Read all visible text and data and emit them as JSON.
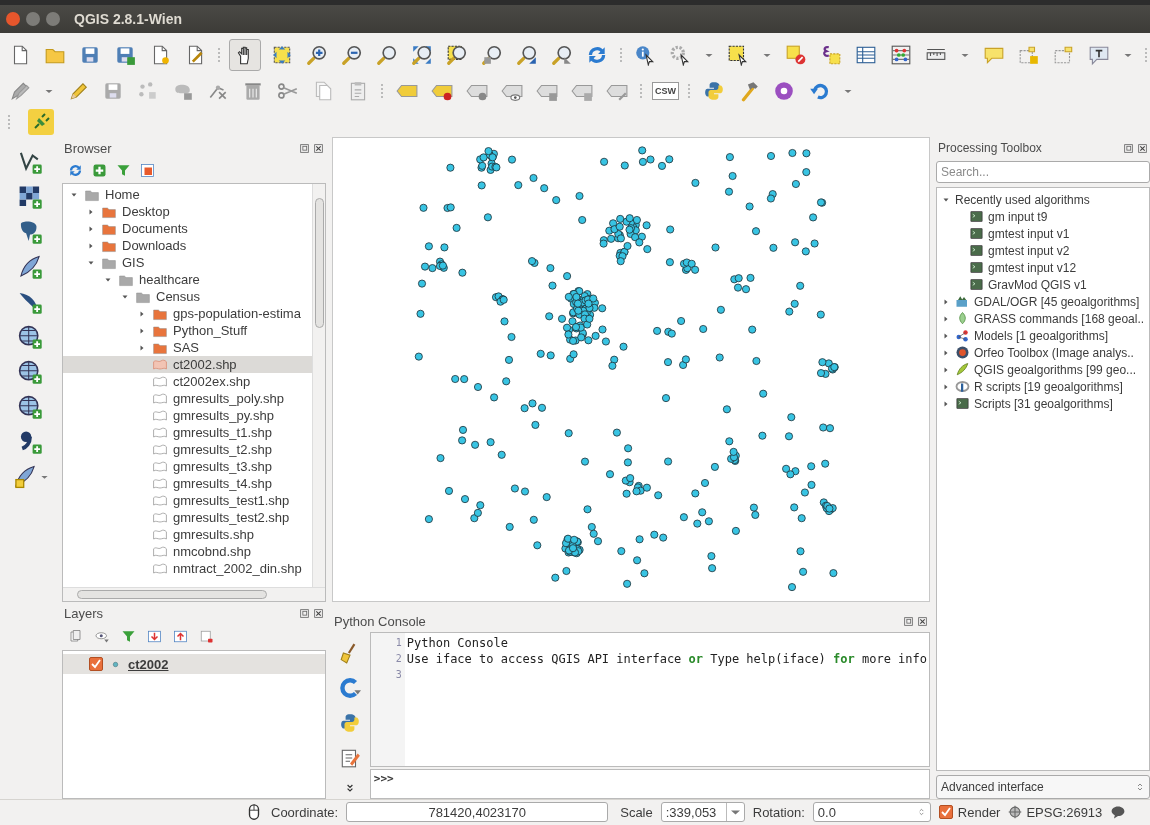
{
  "window": {
    "title": "QGIS 2.8.1-Wien"
  },
  "toolbar": {
    "pan_tool": {
      "selected": true
    },
    "csw_label": "CSW"
  },
  "browser": {
    "title": "Browser",
    "tree": [
      {
        "label": "Home",
        "kind": "folder",
        "expanded": true,
        "selected": false,
        "children": [
          {
            "label": "Desktop",
            "kind": "folder",
            "expanded": false,
            "selected": false
          },
          {
            "label": "Documents",
            "kind": "folder",
            "expanded": false,
            "selected": false
          },
          {
            "label": "Downloads",
            "kind": "folder",
            "expanded": false,
            "selected": false
          },
          {
            "label": "GIS",
            "kind": "folder",
            "expanded": true,
            "selected": false,
            "children": [
              {
                "label": "healthcare",
                "kind": "folder",
                "expanded": true,
                "selected": false,
                "children": [
                  {
                    "label": "Census",
                    "kind": "folder",
                    "expanded": true,
                    "selected": false,
                    "children": [
                      {
                        "label": "gps-population-estima",
                        "kind": "folder",
                        "expanded": false,
                        "selected": false
                      },
                      {
                        "label": "Python_Stuff",
                        "kind": "folder",
                        "expanded": false,
                        "selected": false
                      },
                      {
                        "label": "SAS",
                        "kind": "folder",
                        "expanded": false,
                        "selected": false
                      },
                      {
                        "label": "ct2002.shp",
                        "kind": "file",
                        "selected": true
                      },
                      {
                        "label": "ct2002ex.shp",
                        "kind": "file",
                        "selected": false
                      },
                      {
                        "label": "gmresults_poly.shp",
                        "kind": "file",
                        "selected": false
                      },
                      {
                        "label": "gmresults_py.shp",
                        "kind": "file",
                        "selected": false
                      },
                      {
                        "label": "gmresults_t1.shp",
                        "kind": "file",
                        "selected": false
                      },
                      {
                        "label": "gmresults_t2.shp",
                        "kind": "file",
                        "selected": false
                      },
                      {
                        "label": "gmresults_t3.shp",
                        "kind": "file",
                        "selected": false
                      },
                      {
                        "label": "gmresults_t4.shp",
                        "kind": "file",
                        "selected": false
                      },
                      {
                        "label": "gmresults_test1.shp",
                        "kind": "file",
                        "selected": false
                      },
                      {
                        "label": "gmresults_test2.shp",
                        "kind": "file",
                        "selected": false
                      },
                      {
                        "label": "gmresults.shp",
                        "kind": "file",
                        "selected": false
                      },
                      {
                        "label": "nmcobnd.shp",
                        "kind": "file",
                        "selected": false
                      },
                      {
                        "label": "nmtract_2002_din.shp",
                        "kind": "file",
                        "selected": false
                      }
                    ]
                  }
                ]
              }
            ]
          }
        ]
      }
    ]
  },
  "layers": {
    "title": "Layers",
    "items": [
      {
        "label": "ct2002",
        "checked": true,
        "selected": true
      }
    ]
  },
  "console": {
    "title": "Python Console",
    "lines": [
      {
        "number": "1",
        "segments": [
          {
            "text": "Python Console",
            "kind": "plain"
          }
        ]
      },
      {
        "number": "2",
        "segments": [
          {
            "text": "Use iface to access QGIS API interface ",
            "kind": "plain"
          },
          {
            "text": "or",
            "kind": "keyword"
          },
          {
            "text": " Type help(iface) ",
            "kind": "plain"
          },
          {
            "text": "for",
            "kind": "keyword"
          },
          {
            "text": " more info",
            "kind": "plain"
          }
        ]
      },
      {
        "number": "3"
      }
    ],
    "prompt": ">>>"
  },
  "toolbox": {
    "title": "Processing Toolbox",
    "search": {
      "placeholder": "Search..."
    },
    "groups": [
      {
        "label": "Recently used algorithms",
        "kind": "recent",
        "expanded": true,
        "children": [
          {
            "label": "gm input t9"
          },
          {
            "label": "gmtest input v1"
          },
          {
            "label": "gmtest input v2"
          },
          {
            "label": "gmtest input v12"
          },
          {
            "label": "GravMod QGIS v1"
          }
        ]
      },
      {
        "label": "GDAL/OGR [45 geoalgorithms]",
        "kind": "gdal",
        "expanded": false
      },
      {
        "label": "GRASS commands [168 geoal..",
        "kind": "grass",
        "expanded": false
      },
      {
        "label": "Models [1 geoalgorithms]",
        "kind": "models",
        "expanded": false
      },
      {
        "label": "Orfeo Toolbox (Image analys..",
        "kind": "orfeo",
        "expanded": false
      },
      {
        "label": "QGIS geoalgorithms [99 geo...",
        "kind": "qgis",
        "expanded": false
      },
      {
        "label": "R scripts [19 geoalgorithms]",
        "kind": "r",
        "expanded": false
      },
      {
        "label": "Scripts [31 geoalgorithms]",
        "kind": "scripts",
        "expanded": false
      }
    ],
    "mode": "Advanced interface"
  },
  "status_bar": {
    "coordinate_label": "Coordinate:",
    "coordinate": "781420,4023170",
    "scale_label": "Scale",
    "scale": ":339,053",
    "rotation_label": "Rotation:",
    "rotation": "0.0",
    "render": {
      "label": "Render",
      "checked": true
    },
    "crs": "EPSG:26913"
  }
}
